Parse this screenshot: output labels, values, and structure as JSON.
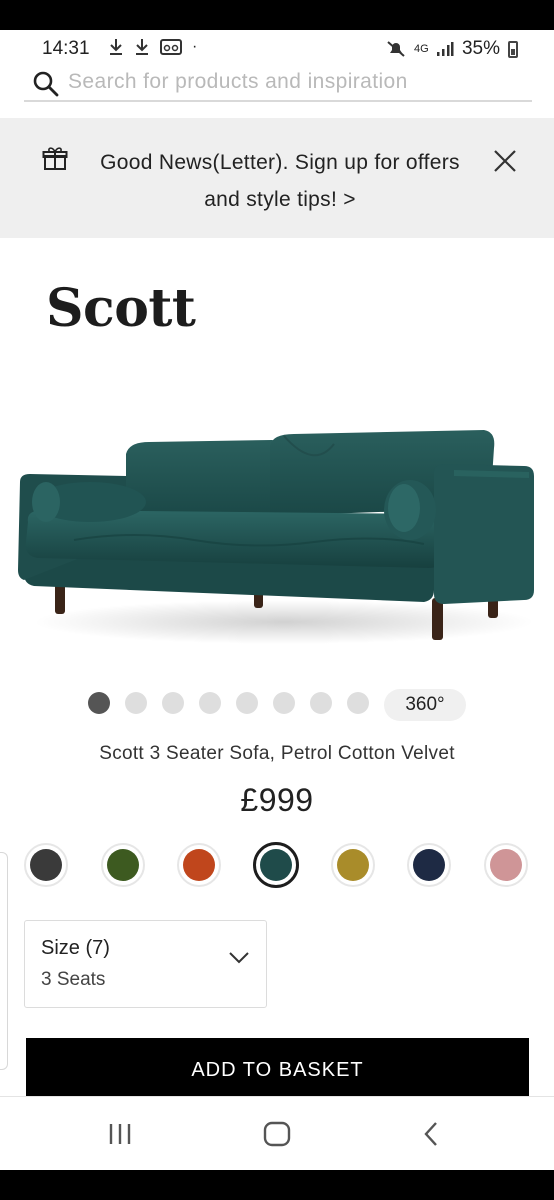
{
  "status_bar": {
    "time": "14:31",
    "network": "4G",
    "battery": "35%",
    "icons": [
      "download-icon",
      "download-icon",
      "voicemail-icon",
      "dot-icon",
      "mute-icon",
      "signal-icon",
      "battery-icon"
    ]
  },
  "search": {
    "placeholder": "Search for products and inspiration",
    "icon": "search-icon"
  },
  "banner": {
    "message": "Good News(Letter). Sign up for offers and style tips! >",
    "icon": "gift-icon",
    "close_icon": "close-icon"
  },
  "product": {
    "title": "Scott",
    "name": "Scott 3 Seater Sofa, Petrol Cotton Velvet",
    "price": "£999",
    "image_icon": "sofa-image",
    "carousel": {
      "total": 8,
      "active_index": 0,
      "view_360_label": "360°"
    },
    "swatches": [
      {
        "name": "charcoal",
        "color": "#3a3a3a",
        "selected": false
      },
      {
        "name": "olive",
        "color": "#3d5a20",
        "selected": false
      },
      {
        "name": "burnt-orange",
        "color": "#c0461c",
        "selected": false
      },
      {
        "name": "petrol",
        "color": "#1f4b4a",
        "selected": true
      },
      {
        "name": "mustard",
        "color": "#a98c2a",
        "selected": false
      },
      {
        "name": "navy",
        "color": "#1e2a44",
        "selected": false
      },
      {
        "name": "blush-pink",
        "color": "#cf9597",
        "selected": false
      }
    ],
    "size": {
      "label": "Size (7)",
      "value": "3 Seats"
    },
    "add_to_basket_label": "ADD TO BASKET"
  },
  "navbar": {
    "icons": [
      "recent-apps-icon",
      "home-icon",
      "back-icon"
    ]
  },
  "colors": {
    "sofa": "#1f4b4a",
    "button": "#000000",
    "banner_bg": "#efefef"
  }
}
